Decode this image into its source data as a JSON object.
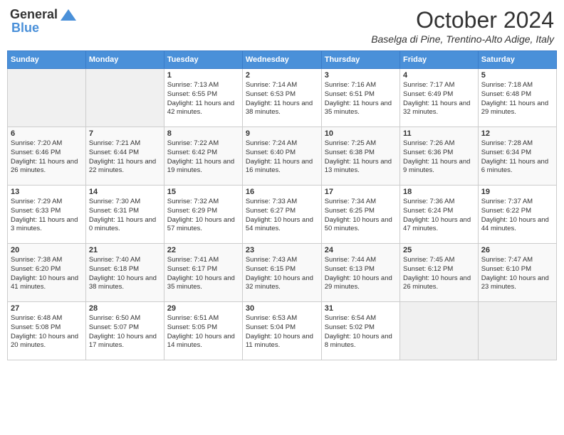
{
  "header": {
    "logo_line1": "General",
    "logo_line2": "Blue",
    "month_title": "October 2024",
    "location": "Baselga di Pine, Trentino-Alto Adige, Italy"
  },
  "days_of_week": [
    "Sunday",
    "Monday",
    "Tuesday",
    "Wednesday",
    "Thursday",
    "Friday",
    "Saturday"
  ],
  "weeks": [
    [
      {
        "day": "",
        "info": ""
      },
      {
        "day": "",
        "info": ""
      },
      {
        "day": "1",
        "info": "Sunrise: 7:13 AM\nSunset: 6:55 PM\nDaylight: 11 hours and 42 minutes."
      },
      {
        "day": "2",
        "info": "Sunrise: 7:14 AM\nSunset: 6:53 PM\nDaylight: 11 hours and 38 minutes."
      },
      {
        "day": "3",
        "info": "Sunrise: 7:16 AM\nSunset: 6:51 PM\nDaylight: 11 hours and 35 minutes."
      },
      {
        "day": "4",
        "info": "Sunrise: 7:17 AM\nSunset: 6:49 PM\nDaylight: 11 hours and 32 minutes."
      },
      {
        "day": "5",
        "info": "Sunrise: 7:18 AM\nSunset: 6:48 PM\nDaylight: 11 hours and 29 minutes."
      }
    ],
    [
      {
        "day": "6",
        "info": "Sunrise: 7:20 AM\nSunset: 6:46 PM\nDaylight: 11 hours and 26 minutes."
      },
      {
        "day": "7",
        "info": "Sunrise: 7:21 AM\nSunset: 6:44 PM\nDaylight: 11 hours and 22 minutes."
      },
      {
        "day": "8",
        "info": "Sunrise: 7:22 AM\nSunset: 6:42 PM\nDaylight: 11 hours and 19 minutes."
      },
      {
        "day": "9",
        "info": "Sunrise: 7:24 AM\nSunset: 6:40 PM\nDaylight: 11 hours and 16 minutes."
      },
      {
        "day": "10",
        "info": "Sunrise: 7:25 AM\nSunset: 6:38 PM\nDaylight: 11 hours and 13 minutes."
      },
      {
        "day": "11",
        "info": "Sunrise: 7:26 AM\nSunset: 6:36 PM\nDaylight: 11 hours and 9 minutes."
      },
      {
        "day": "12",
        "info": "Sunrise: 7:28 AM\nSunset: 6:34 PM\nDaylight: 11 hours and 6 minutes."
      }
    ],
    [
      {
        "day": "13",
        "info": "Sunrise: 7:29 AM\nSunset: 6:33 PM\nDaylight: 11 hours and 3 minutes."
      },
      {
        "day": "14",
        "info": "Sunrise: 7:30 AM\nSunset: 6:31 PM\nDaylight: 11 hours and 0 minutes."
      },
      {
        "day": "15",
        "info": "Sunrise: 7:32 AM\nSunset: 6:29 PM\nDaylight: 10 hours and 57 minutes."
      },
      {
        "day": "16",
        "info": "Sunrise: 7:33 AM\nSunset: 6:27 PM\nDaylight: 10 hours and 54 minutes."
      },
      {
        "day": "17",
        "info": "Sunrise: 7:34 AM\nSunset: 6:25 PM\nDaylight: 10 hours and 50 minutes."
      },
      {
        "day": "18",
        "info": "Sunrise: 7:36 AM\nSunset: 6:24 PM\nDaylight: 10 hours and 47 minutes."
      },
      {
        "day": "19",
        "info": "Sunrise: 7:37 AM\nSunset: 6:22 PM\nDaylight: 10 hours and 44 minutes."
      }
    ],
    [
      {
        "day": "20",
        "info": "Sunrise: 7:38 AM\nSunset: 6:20 PM\nDaylight: 10 hours and 41 minutes."
      },
      {
        "day": "21",
        "info": "Sunrise: 7:40 AM\nSunset: 6:18 PM\nDaylight: 10 hours and 38 minutes."
      },
      {
        "day": "22",
        "info": "Sunrise: 7:41 AM\nSunset: 6:17 PM\nDaylight: 10 hours and 35 minutes."
      },
      {
        "day": "23",
        "info": "Sunrise: 7:43 AM\nSunset: 6:15 PM\nDaylight: 10 hours and 32 minutes."
      },
      {
        "day": "24",
        "info": "Sunrise: 7:44 AM\nSunset: 6:13 PM\nDaylight: 10 hours and 29 minutes."
      },
      {
        "day": "25",
        "info": "Sunrise: 7:45 AM\nSunset: 6:12 PM\nDaylight: 10 hours and 26 minutes."
      },
      {
        "day": "26",
        "info": "Sunrise: 7:47 AM\nSunset: 6:10 PM\nDaylight: 10 hours and 23 minutes."
      }
    ],
    [
      {
        "day": "27",
        "info": "Sunrise: 6:48 AM\nSunset: 5:08 PM\nDaylight: 10 hours and 20 minutes."
      },
      {
        "day": "28",
        "info": "Sunrise: 6:50 AM\nSunset: 5:07 PM\nDaylight: 10 hours and 17 minutes."
      },
      {
        "day": "29",
        "info": "Sunrise: 6:51 AM\nSunset: 5:05 PM\nDaylight: 10 hours and 14 minutes."
      },
      {
        "day": "30",
        "info": "Sunrise: 6:53 AM\nSunset: 5:04 PM\nDaylight: 10 hours and 11 minutes."
      },
      {
        "day": "31",
        "info": "Sunrise: 6:54 AM\nSunset: 5:02 PM\nDaylight: 10 hours and 8 minutes."
      },
      {
        "day": "",
        "info": ""
      },
      {
        "day": "",
        "info": ""
      }
    ]
  ]
}
